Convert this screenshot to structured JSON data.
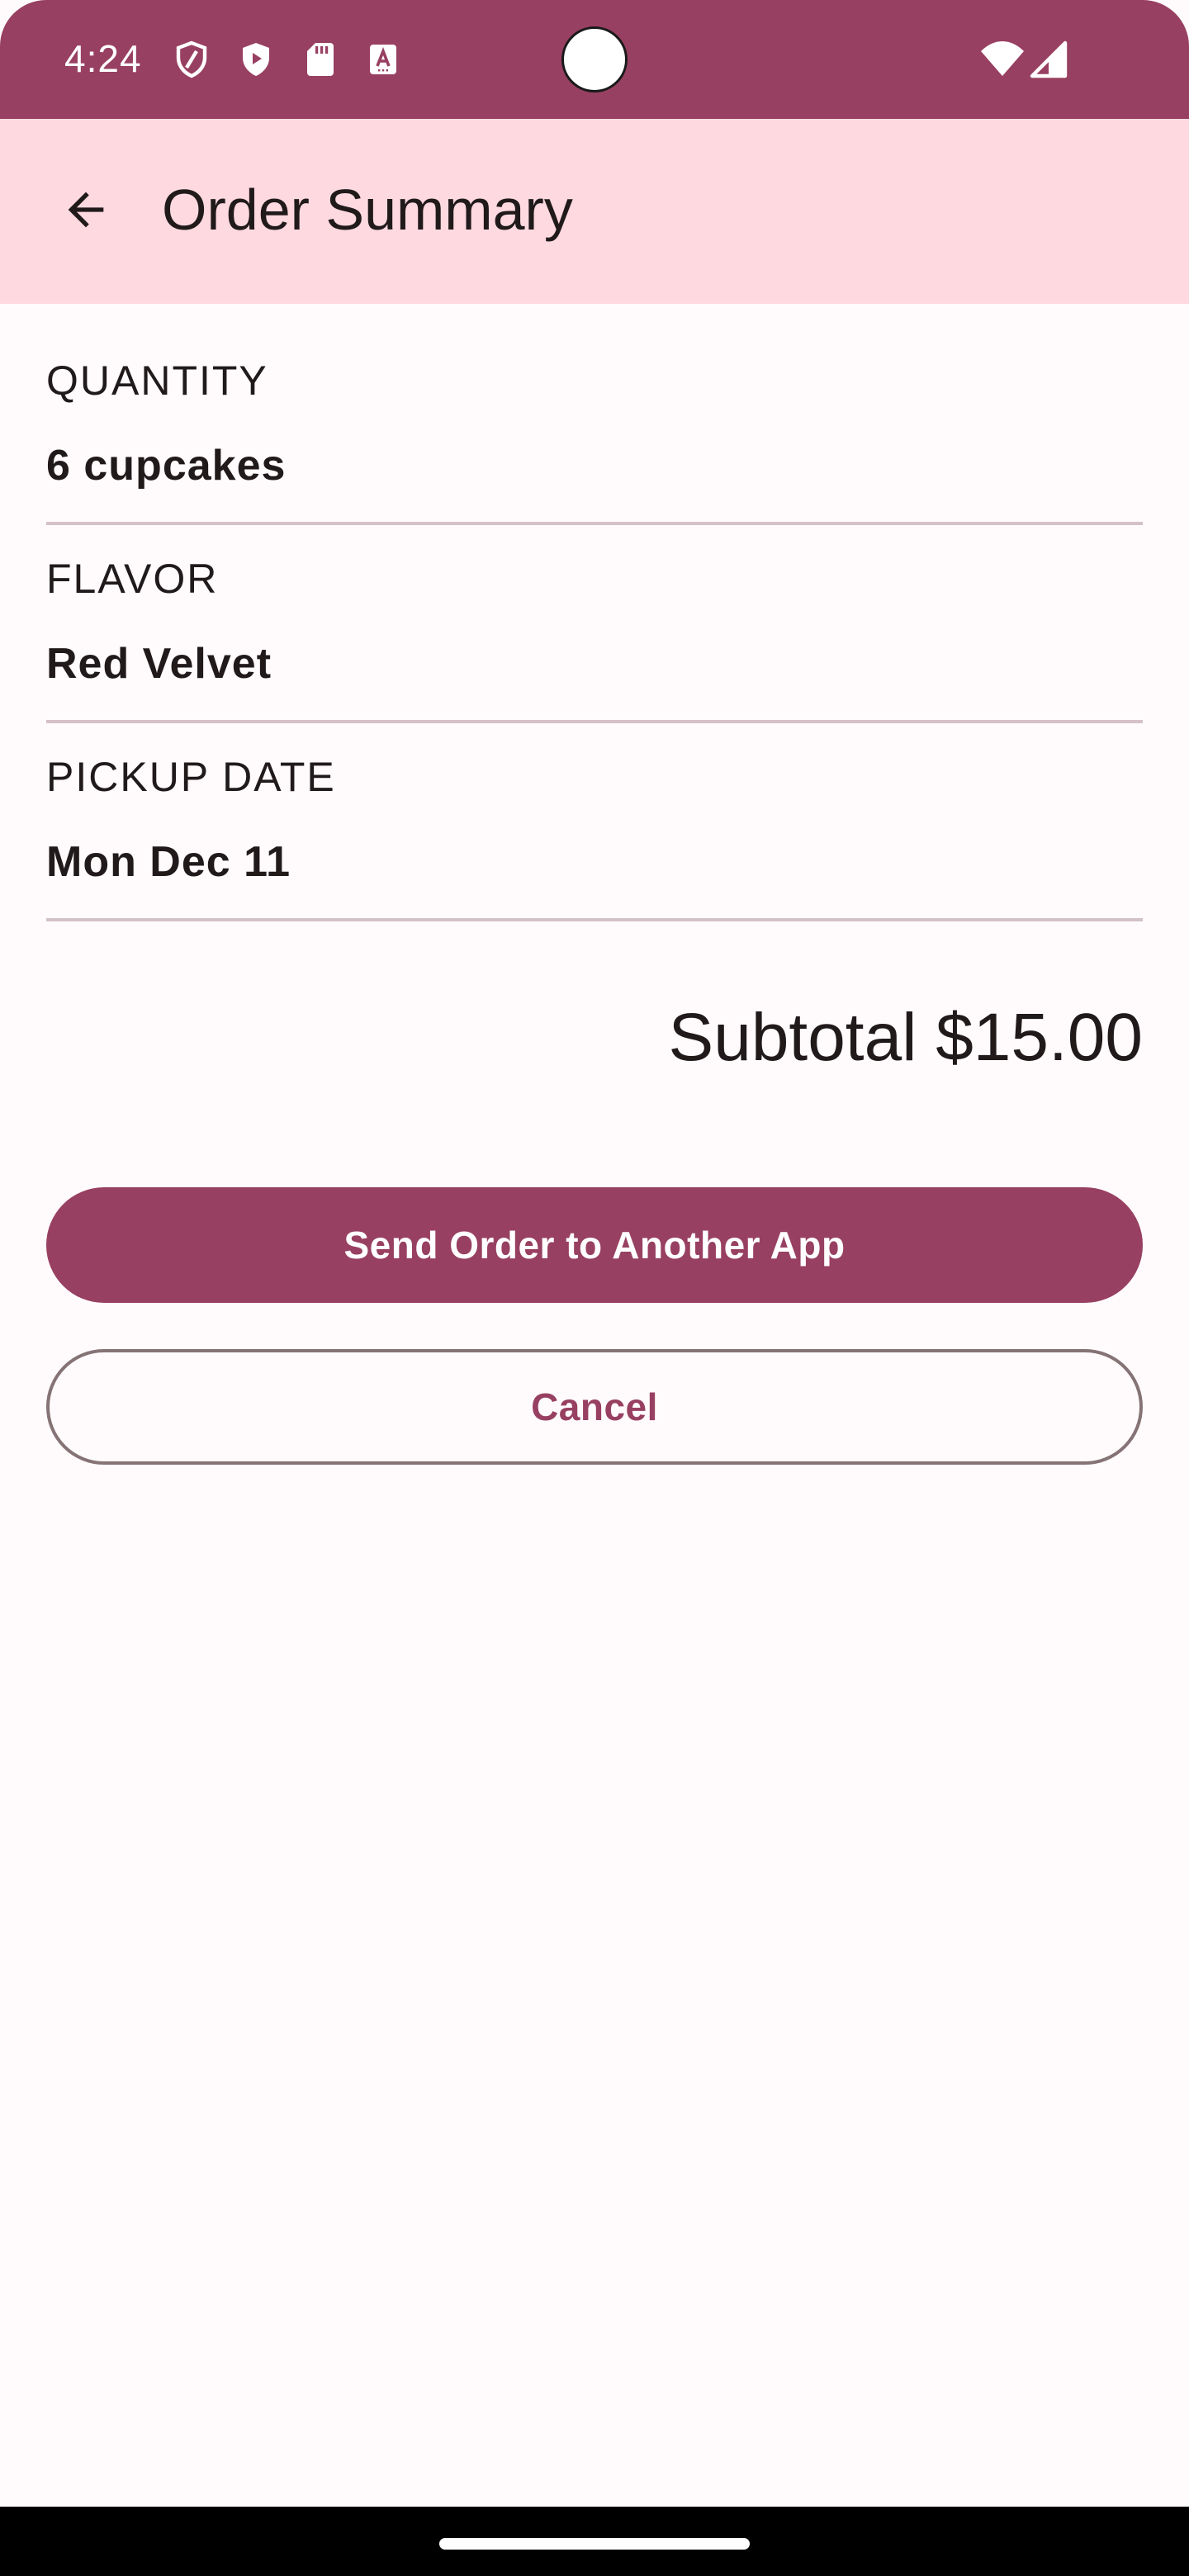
{
  "status_bar": {
    "time": "4:24",
    "icons": [
      "shield-icon",
      "play-shield-icon",
      "sd-card-icon",
      "font-icon",
      "wifi-icon",
      "signal-icon"
    ]
  },
  "app_bar": {
    "title": "Order Summary",
    "back_icon": "arrow-back-icon"
  },
  "summary": {
    "quantity": {
      "label": "QUANTITY",
      "value": "6 cupcakes"
    },
    "flavor": {
      "label": "FLAVOR",
      "value": "Red Velvet"
    },
    "pickup_date": {
      "label": "PICKUP DATE",
      "value": "Mon Dec 11"
    },
    "subtotal": "Subtotal $15.00"
  },
  "actions": {
    "send_label": "Send Order to Another App",
    "cancel_label": "Cancel"
  },
  "colors": {
    "primary": "#984061",
    "app_bar_bg": "#ffd9e0",
    "background": "#fffbfd",
    "divider": "#d5c2c6",
    "outline": "#857376"
  }
}
